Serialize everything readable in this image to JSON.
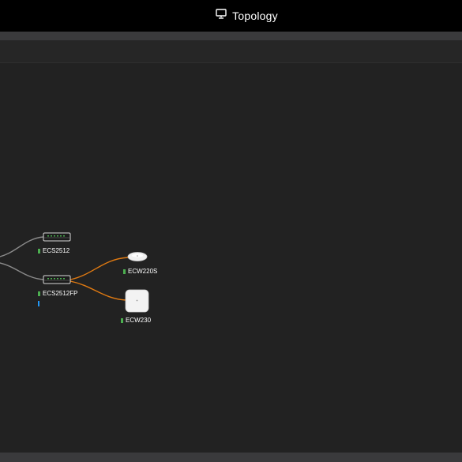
{
  "header": {
    "title": "Topology",
    "icon": "monitor-icon"
  },
  "colors": {
    "wired_link": "#8a8a8a",
    "wireless_link": "#e07a12",
    "online_status": "#4caf50",
    "port_marker": "#2196f3"
  },
  "topology": {
    "devices": [
      {
        "name": "ECS2512",
        "type": "switch",
        "status": "online"
      },
      {
        "name": "ECS2512FP",
        "type": "switch",
        "status": "online"
      },
      {
        "name": "ECW220S",
        "type": "access-point",
        "status": "online"
      },
      {
        "name": "ECW230",
        "type": "access-point",
        "status": "online"
      }
    ]
  }
}
